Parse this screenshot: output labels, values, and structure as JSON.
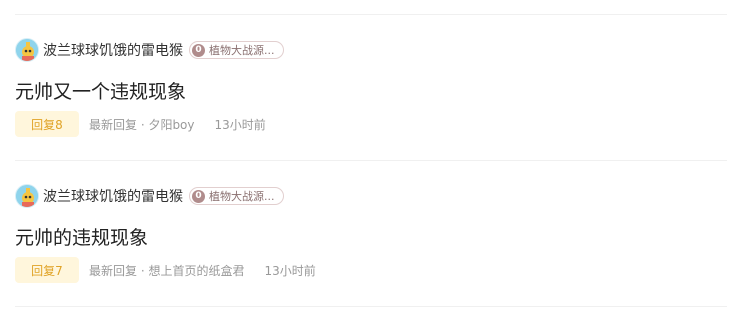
{
  "posts": [
    {
      "author": "波兰球球饥饿的雷电猴",
      "tag_level": "0",
      "tag_label": "植物大战源...",
      "title": "元帅又一个违规现象",
      "reply_label": "回复8",
      "latest_reply": "最新回复 · 夕阳boy",
      "time": "13小时前"
    },
    {
      "author": "波兰球球饥饿的雷电猴",
      "tag_level": "0",
      "tag_label": "植物大战源...",
      "title": "元帅的违规现象",
      "reply_label": "回复7",
      "latest_reply": "最新回复 · 想上首页的纸盒君",
      "time": "13小时前"
    }
  ],
  "colors": {
    "reply_badge_bg": "#fff6dc",
    "reply_badge_text": "#e0a326",
    "meta_text": "#999999",
    "title_text": "#222222",
    "tag_border": "#e2cfcf"
  },
  "icons": {
    "avatar": "avatar-icon",
    "level": "level-badge-icon"
  }
}
